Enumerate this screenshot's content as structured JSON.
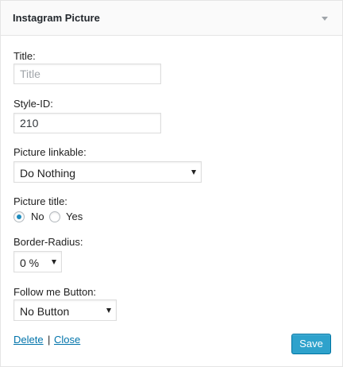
{
  "widget": {
    "title": "Instagram Picture"
  },
  "form": {
    "title_label": "Title:",
    "title_placeholder": "Title",
    "title_value": "",
    "style_id_label": "Style-ID:",
    "style_id_value": "210",
    "picture_linkable_label": "Picture linkable:",
    "picture_linkable_value": "Do Nothing",
    "picture_title_label": "Picture title:",
    "picture_title_options": [
      {
        "label": "No",
        "checked": true
      },
      {
        "label": "Yes",
        "checked": false
      }
    ],
    "border_radius_label": "Border-Radius:",
    "border_radius_value": "0 %",
    "follow_button_label": "Follow me Button:",
    "follow_button_value": "No Button"
  },
  "footer": {
    "delete_label": "Delete",
    "separator": "|",
    "close_label": "Close",
    "save_label": "Save"
  },
  "colors": {
    "accent": "#2ea2cc",
    "link": "#0073aa",
    "radio_checked": "#1e8cbe"
  }
}
